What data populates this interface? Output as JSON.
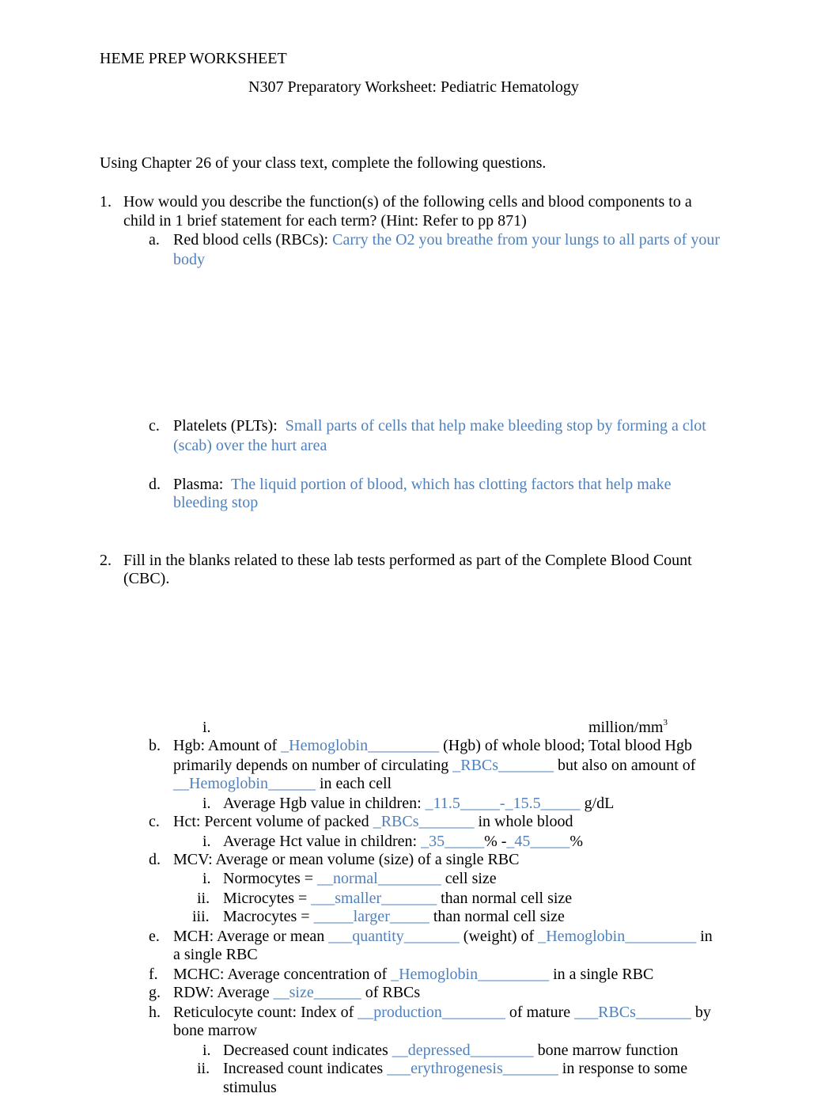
{
  "header": {
    "label": "HEME PREP WORKSHEET",
    "title": "N307 Preparatory Worksheet: Pediatric Hematology"
  },
  "intro": "Using Chapter 26 of your class text, complete the following questions.",
  "colors": {
    "answer": "#4f81bd",
    "text": "#000000"
  },
  "q1": {
    "number": "1.",
    "line1": "How would you describe the function(s) of the following cells and blood components to a",
    "line2": "child in 1 brief statement for each term? (Hint: Refer to pp 871)",
    "items": [
      {
        "marker": "a.",
        "label": "Red blood cells (RBCs):",
        "answer_line1": "Carry the O2 you breathe from your lungs to all parts of your",
        "answer_line2": "body"
      },
      {
        "marker": "c.",
        "label": "Platelets (PLTs):",
        "answer_line1": "Small parts of cells that help make bleeding stop by forming a clot",
        "answer_line2": "(scab) over the hurt area"
      },
      {
        "marker": "d.",
        "label": "Plasma:",
        "answer_line1": "The liquid portion of blood, which has clotting factors that help make",
        "answer_line2": "bleeding stop"
      }
    ]
  },
  "q2": {
    "number": "2.",
    "line1": "Fill in the blanks related to these lab tests performed as part of the Complete Blood Count",
    "line2": "(CBC).",
    "a_i": {
      "marker": "i.",
      "unit": "million/mm",
      "unit_sup": "3"
    },
    "b": {
      "marker": "b.",
      "t1": "Hgb: Amount of ",
      "a1": "_Hemoglobin_________",
      "t2": " (Hgb) of whole blood; Total blood Hgb",
      "t3": "primarily depends on number of circulating ",
      "a2": "_RBCs_______",
      "t4": " but also on amount of",
      "a3": "__Hemoglobin______",
      "t5": " in each cell",
      "i": {
        "marker": "i.",
        "t1": "Average Hgb value in children: ",
        "a1": "_11.5_____-_15.5_____",
        "t2": " g/dL"
      }
    },
    "c": {
      "marker": "c.",
      "t1": "Hct: Percent volume of packed ",
      "a1": "_RBCs_______",
      "t2": " in whole blood",
      "i": {
        "marker": "i.",
        "t1": "Average Hct value in children: ",
        "a1": "_35_____",
        "t2": "% -",
        "a2": "_45_____",
        "t3": "%"
      }
    },
    "d": {
      "marker": "d.",
      "t1": "MCV: Average or mean volume (size) of a single RBC",
      "subs": [
        {
          "marker": "i.",
          "t1": "Normocytes = ",
          "a1": "__normal________",
          "t2": " cell size"
        },
        {
          "marker": "ii.",
          "t1": "Microcytes = ",
          "a1": "___smaller_______",
          "t2": " than normal cell size"
        },
        {
          "marker": "iii.",
          "t1": "Macrocytes = ",
          "a1": "_____larger_____",
          "t2": " than normal cell size"
        }
      ]
    },
    "e": {
      "marker": "e.",
      "t1": "MCH: Average or mean ",
      "a1": "___quantity_______",
      "t2": " (weight) of ",
      "a2": "_Hemoglobin_________",
      "t3": " in",
      "t4": "a single RBC"
    },
    "f": {
      "marker": "f.",
      "t1": "MCHC: Average concentration of ",
      "a1": "_Hemoglobin_________",
      "t2": " in a single RBC"
    },
    "g": {
      "marker": "g.",
      "t1": "RDW: Average ",
      "a1": "__size______",
      "t2": " of RBCs"
    },
    "h": {
      "marker": "h.",
      "t1": "Reticulocyte count: Index of ",
      "a1": "__production________",
      "t2": " of mature ",
      "a2": "___RBCs_______",
      "t3": " by",
      "t4": "bone marrow",
      "subs": [
        {
          "marker": "i.",
          "t1": "Decreased count indicates ",
          "a1": "__depressed________",
          "t2": " bone marrow function"
        },
        {
          "marker": "ii.",
          "t1": "Increased count indicates ",
          "a1": "___erythrogenesis_______",
          "t2": " in response to some",
          "t3": "stimulus"
        }
      ]
    }
  }
}
